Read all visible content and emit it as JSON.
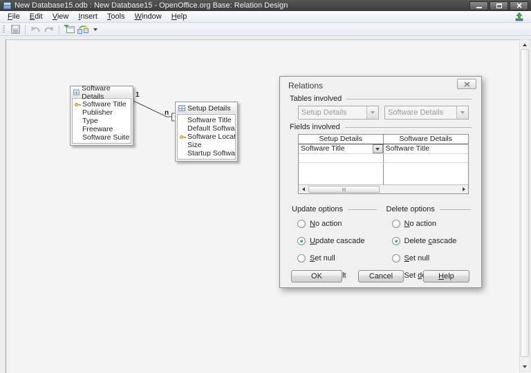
{
  "window": {
    "title": "New Database15.odb : New Database15 - OpenOffice.org Base: Relation Design"
  },
  "menubar": {
    "items": [
      "~File",
      "~Edit",
      "~View",
      "~Insert",
      "~Tools",
      "~Window",
      "~Help"
    ]
  },
  "toolbar": {
    "icons": [
      "save",
      "undo",
      "redo",
      "add-table",
      "new-relation"
    ]
  },
  "canvas": {
    "tables": [
      {
        "title": "Software Details",
        "fields": [
          {
            "name": "Software Title",
            "key": true
          },
          {
            "name": "Publisher",
            "key": false
          },
          {
            "name": "Type",
            "key": false
          },
          {
            "name": "Freeware",
            "key": false
          },
          {
            "name": "Software Suite",
            "key": false
          }
        ]
      },
      {
        "title": "Setup Details",
        "fields": [
          {
            "name": "Software Title",
            "key": false
          },
          {
            "name": "Default Software",
            "key": false
          },
          {
            "name": "Software Location",
            "key": true
          },
          {
            "name": "Size",
            "key": false
          },
          {
            "name": "Startup Software",
            "key": false
          }
        ]
      }
    ],
    "relation": {
      "one_label": "1",
      "many_label": "n"
    }
  },
  "dialog": {
    "title": "Relations",
    "tables_involved": {
      "label": "Tables involved",
      "left_table": "Setup Details",
      "right_table": "Software Details"
    },
    "fields_involved": {
      "label": "Fields involved",
      "headers": [
        "Setup Details",
        "Software Details"
      ],
      "rows": [
        [
          "Software Title",
          "Software Title"
        ],
        [
          "",
          ""
        ]
      ]
    },
    "update_options": {
      "label": "Update options",
      "options": [
        "~No action",
        "~Update cascade",
        "~Set null",
        "Set ~default"
      ],
      "selected": 1
    },
    "delete_options": {
      "label": "Delete options",
      "options": [
        "~No action",
        "Delete ~cascade",
        "~Set null",
        "Set ~default"
      ],
      "selected": 1
    },
    "buttons": {
      "ok": "OK",
      "cancel": "Cancel",
      "help": "~Help"
    }
  }
}
